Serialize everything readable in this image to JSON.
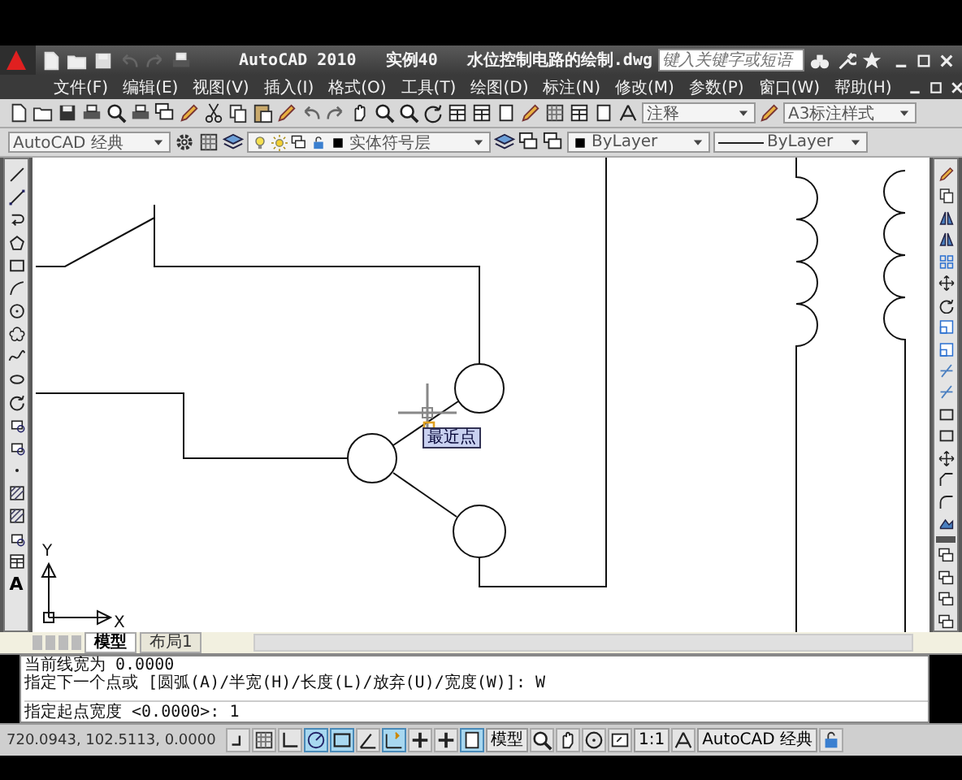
{
  "window": {
    "title": "AutoCAD 2010   实例40   水位控制电路的绘制.dwg"
  },
  "search": {
    "placeholder": "键入关键字或短语"
  },
  "menu": [
    "文件(F)",
    "编辑(E)",
    "视图(V)",
    "插入(I)",
    "格式(O)",
    "工具(T)",
    "绘图(D)",
    "标注(N)",
    "修改(M)",
    "参数(P)",
    "窗口(W)",
    "帮助(H)"
  ],
  "toolbar": {
    "text_style": "注释",
    "dim_style": "A3标注样式",
    "workspace": "AutoCAD 经典",
    "layer": "实体符号层",
    "color_setting": "ByLayer",
    "linetype": "ByLayer"
  },
  "draw_toolbar": {
    "text_tool": "A"
  },
  "canvas": {
    "tooltip": "最近点",
    "ucs_y": "Y",
    "ucs_x": "X"
  },
  "tabs": [
    {
      "label": "模型",
      "selected": true
    },
    {
      "label": "布局1",
      "selected": false
    }
  ],
  "command_lines": [
    "当前线宽为 0.0000",
    "指定下一个点或 [圆弧(A)/半宽(H)/长度(L)/放弃(U)/宽度(W)]: W"
  ],
  "command_prompt": "指定起点宽度 <0.0000>: 1",
  "status_bar": {
    "coordinates": "720.0943, 102.5113, 0.0000",
    "toggles": [
      {
        "on": false
      },
      {
        "on": false
      },
      {
        "on": false
      },
      {
        "on": true
      },
      {
        "on": true
      },
      {
        "on": false
      },
      {
        "on": true
      },
      {
        "on": false
      },
      {
        "on": false
      },
      {
        "on": true
      }
    ],
    "model": "模型",
    "scale": "1:1",
    "workspace": "AutoCAD 经典"
  }
}
